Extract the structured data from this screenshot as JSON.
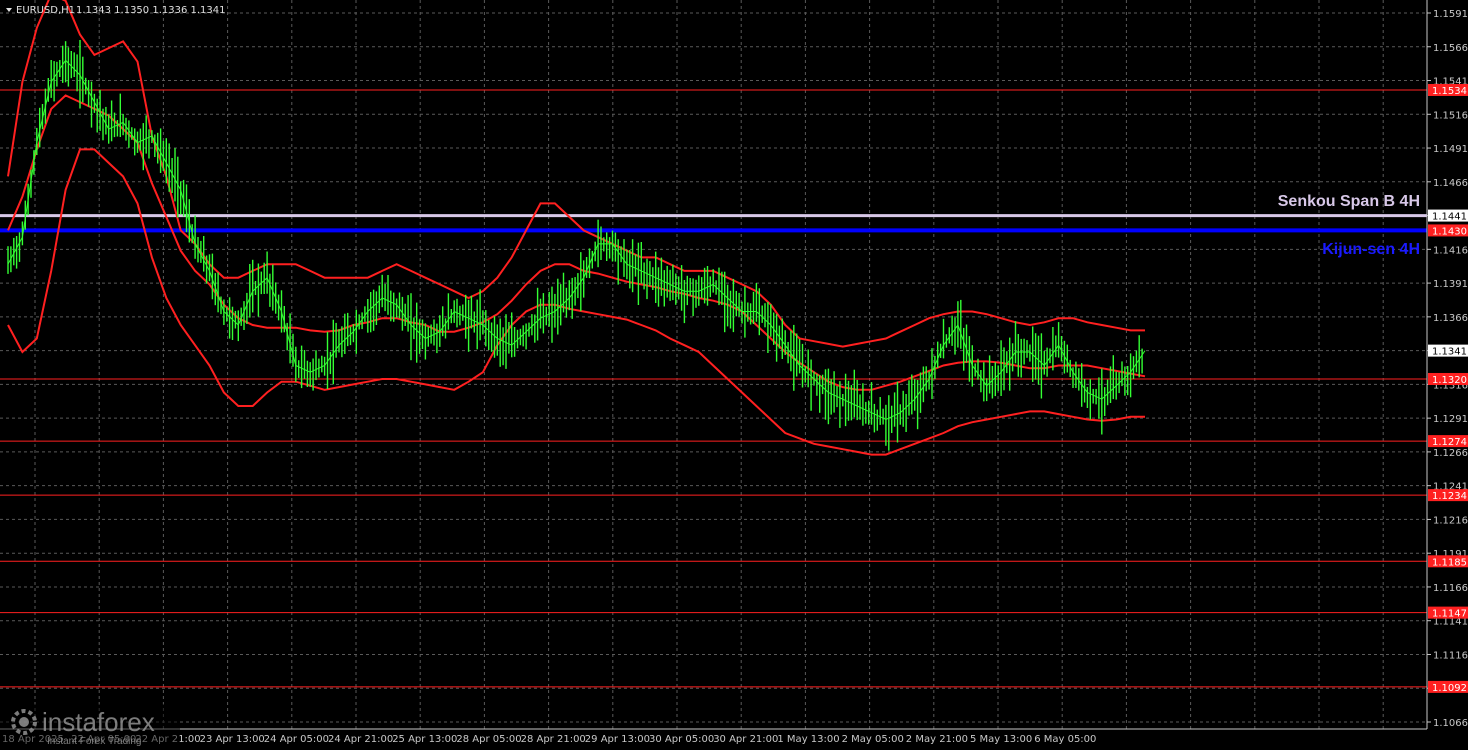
{
  "chart_data": {
    "type": "line",
    "symbol": "EURUSD,H1",
    "ohlc_text": "1.1343 1.1350 1.1336 1.1341",
    "y_axis": {
      "ylim": [
        1.1056,
        1.1602
      ],
      "ticks": [
        "1.1591",
        "1.1566",
        "1.1541",
        "1.1516",
        "1.1491",
        "1.1466",
        "1.1441",
        "1.1416",
        "1.1391",
        "1.1366",
        "1.1341",
        "1.1316",
        "1.1291",
        "1.1266",
        "1.1241",
        "1.1216",
        "1.1191",
        "1.1166",
        "1.1141",
        "1.1116",
        "1.1091",
        "1.1066"
      ]
    },
    "x_axis": {
      "ticks": [
        "18 Apr 2025",
        "22 Apr 05:00",
        "22 Apr 21:00",
        "23 Apr 13:00",
        "24 Apr 05:00",
        "24 Apr 21:00",
        "25 Apr 13:00",
        "28 Apr 05:00",
        "28 Apr 21:00",
        "29 Apr 13:00",
        "30 Apr 05:00",
        "30 Apr 21:00",
        "1 May 13:00",
        "2 May 05:00",
        "2 May 21:00",
        "5 May 13:00",
        "6 May 05:00"
      ]
    },
    "grid": true,
    "colors": {
      "background": "#000000",
      "grid": "#5a5a5a",
      "price": "#33ff33",
      "bands": "#ff2020",
      "level": "#ff2020",
      "kijun": "#0000ff",
      "senkou": "#d8c8e8"
    },
    "levels": [
      {
        "value": 1.1534,
        "label": "1.1534"
      },
      {
        "value": 1.132,
        "label": "1.1320"
      },
      {
        "value": 1.1274,
        "label": "1.1274"
      },
      {
        "value": 1.1234,
        "label": "1.1234"
      },
      {
        "value": 1.1185,
        "label": "1.1185"
      },
      {
        "value": 1.1147,
        "label": "1.1147"
      },
      {
        "value": 1.1092,
        "label": "1.1092"
      }
    ],
    "kijun": {
      "value": 1.143,
      "label": "1.1430",
      "name": "Kijun-sen 4H"
    },
    "senkou": {
      "value": 1.1441,
      "label": "1.1441",
      "name": "Senkou Span B 4H"
    },
    "current_price": {
      "value": 1.1341,
      "label": "1.1341"
    },
    "close_series": {
      "name": "",
      "values": [
        1.1405,
        1.1425,
        1.1495,
        1.154,
        1.1556,
        1.1545,
        1.1525,
        1.1505,
        1.151,
        1.1495,
        1.15,
        1.148,
        1.146,
        1.142,
        1.14,
        1.137,
        1.136,
        1.1385,
        1.1395,
        1.137,
        1.133,
        1.1325,
        1.133,
        1.1345,
        1.1355,
        1.137,
        1.138,
        1.1375,
        1.136,
        1.135,
        1.1355,
        1.137,
        1.1365,
        1.136,
        1.135,
        1.1345,
        1.1355,
        1.1365,
        1.137,
        1.138,
        1.1395,
        1.142,
        1.142,
        1.1405,
        1.14,
        1.1395,
        1.139,
        1.1385,
        1.1385,
        1.139,
        1.138,
        1.137,
        1.137,
        1.136,
        1.1345,
        1.133,
        1.132,
        1.131,
        1.1305,
        1.13,
        1.1295,
        1.129,
        1.1295,
        1.1305,
        1.132,
        1.1345,
        1.136,
        1.133,
        1.1315,
        1.1325,
        1.134,
        1.134,
        1.133,
        1.1345,
        1.1325,
        1.131,
        1.1305,
        1.1315,
        1.1325,
        1.1341
      ]
    },
    "upper_band": {
      "name": "",
      "values": [
        1.147,
        1.154,
        1.158,
        1.1605,
        1.16,
        1.1575,
        1.156,
        1.1565,
        1.157,
        1.1555,
        1.15,
        1.147,
        1.143,
        1.142,
        1.1405,
        1.1395,
        1.1395,
        1.14,
        1.1405,
        1.1405,
        1.1405,
        1.14,
        1.1395,
        1.1395,
        1.1395,
        1.1395,
        1.14,
        1.1405,
        1.14,
        1.1395,
        1.139,
        1.1385,
        1.138,
        1.1385,
        1.1395,
        1.141,
        1.143,
        1.145,
        1.145,
        1.144,
        1.143,
        1.1425,
        1.142,
        1.1415,
        1.141,
        1.141,
        1.1405,
        1.14,
        1.14,
        1.14,
        1.1395,
        1.139,
        1.1385,
        1.1375,
        1.136,
        1.135,
        1.1348,
        1.1346,
        1.1344,
        1.1346,
        1.1348,
        1.135,
        1.1355,
        1.136,
        1.1365,
        1.1368,
        1.137,
        1.137,
        1.1368,
        1.1365,
        1.1362,
        1.136,
        1.1362,
        1.1365,
        1.1365,
        1.1362,
        1.136,
        1.1358,
        1.1356,
        1.1356
      ]
    },
    "middle_band": {
      "name": "",
      "values": [
        1.143,
        1.1455,
        1.149,
        1.152,
        1.153,
        1.1525,
        1.152,
        1.1515,
        1.1505,
        1.1495,
        1.1465,
        1.144,
        1.1415,
        1.14,
        1.139,
        1.1375,
        1.1365,
        1.136,
        1.1358,
        1.1358,
        1.1358,
        1.1356,
        1.1355,
        1.1356,
        1.136,
        1.1362,
        1.1365,
        1.1365,
        1.1362,
        1.136,
        1.1355,
        1.1355,
        1.1358,
        1.1362,
        1.1368,
        1.1378,
        1.139,
        1.14,
        1.1405,
        1.1405,
        1.14,
        1.1398,
        1.1395,
        1.1392,
        1.139,
        1.1388,
        1.1385,
        1.1383,
        1.138,
        1.1378,
        1.1375,
        1.137,
        1.136,
        1.135,
        1.134,
        1.1332,
        1.1325,
        1.1318,
        1.1314,
        1.1312,
        1.1312,
        1.1315,
        1.1318,
        1.1322,
        1.1326,
        1.133,
        1.1332,
        1.1333,
        1.1333,
        1.1332,
        1.133,
        1.1328,
        1.1328,
        1.133,
        1.133,
        1.133,
        1.1328,
        1.1326,
        1.1324,
        1.1322
      ]
    },
    "lower_band": {
      "name": "",
      "values": [
        1.136,
        1.134,
        1.135,
        1.14,
        1.146,
        1.149,
        1.149,
        1.148,
        1.147,
        1.145,
        1.141,
        1.138,
        1.136,
        1.1345,
        1.133,
        1.131,
        1.13,
        1.13,
        1.131,
        1.1318,
        1.1318,
        1.1315,
        1.1312,
        1.1314,
        1.1316,
        1.1318,
        1.132,
        1.132,
        1.1318,
        1.1316,
        1.1314,
        1.1312,
        1.1318,
        1.1325,
        1.1345,
        1.136,
        1.137,
        1.1375,
        1.1375,
        1.1372,
        1.137,
        1.1368,
        1.1366,
        1.1364,
        1.136,
        1.1356,
        1.135,
        1.1345,
        1.134,
        1.133,
        1.132,
        1.131,
        1.13,
        1.129,
        1.128,
        1.1276,
        1.1272,
        1.127,
        1.1268,
        1.1266,
        1.1264,
        1.1264,
        1.1268,
        1.1272,
        1.1276,
        1.128,
        1.1285,
        1.1288,
        1.129,
        1.1292,
        1.1294,
        1.1296,
        1.1296,
        1.1294,
        1.1292,
        1.129,
        1.1289,
        1.129,
        1.1292,
        1.1292
      ]
    }
  },
  "watermark": {
    "brand": "instaforex",
    "tagline": "Instant Forex Trading"
  }
}
